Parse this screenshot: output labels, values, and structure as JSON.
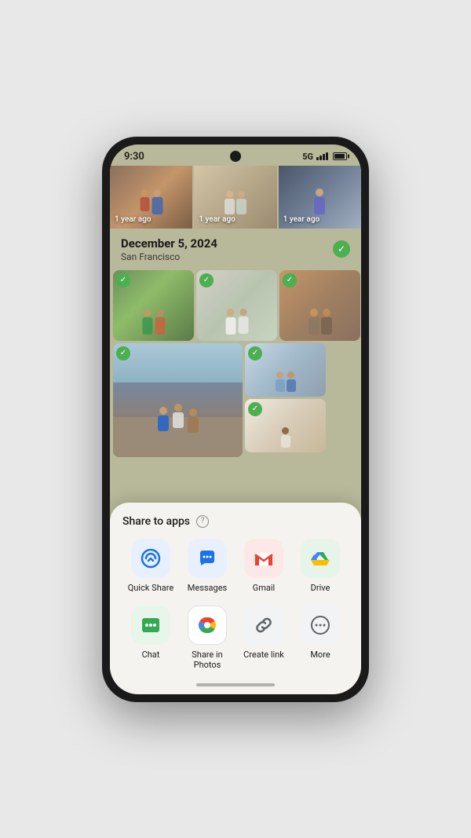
{
  "statusBar": {
    "time": "9:30",
    "network": "5G"
  },
  "memoriesStrip": [
    {
      "label": "1 year ago"
    },
    {
      "label": "1 year ago"
    },
    {
      "label": "1 year ago"
    }
  ],
  "dateSection": {
    "date": "December 5, 2024",
    "location": "San Francisco"
  },
  "shareSheet": {
    "title": "Share to apps",
    "helpIcon": "?",
    "apps": [
      {
        "id": "quick-share",
        "label": "Quick Share",
        "iconType": "quick-share"
      },
      {
        "id": "messages",
        "label": "Messages",
        "iconType": "messages"
      },
      {
        "id": "gmail",
        "label": "Gmail",
        "iconType": "gmail"
      },
      {
        "id": "drive",
        "label": "Drive",
        "iconType": "drive"
      }
    ],
    "appsRow2": [
      {
        "id": "chat",
        "label": "Chat",
        "iconType": "chat"
      },
      {
        "id": "photos",
        "label": "Share in Photos",
        "iconType": "photos"
      },
      {
        "id": "link",
        "label": "Create link",
        "iconType": "link"
      },
      {
        "id": "more",
        "label": "More",
        "iconType": "more"
      }
    ]
  }
}
